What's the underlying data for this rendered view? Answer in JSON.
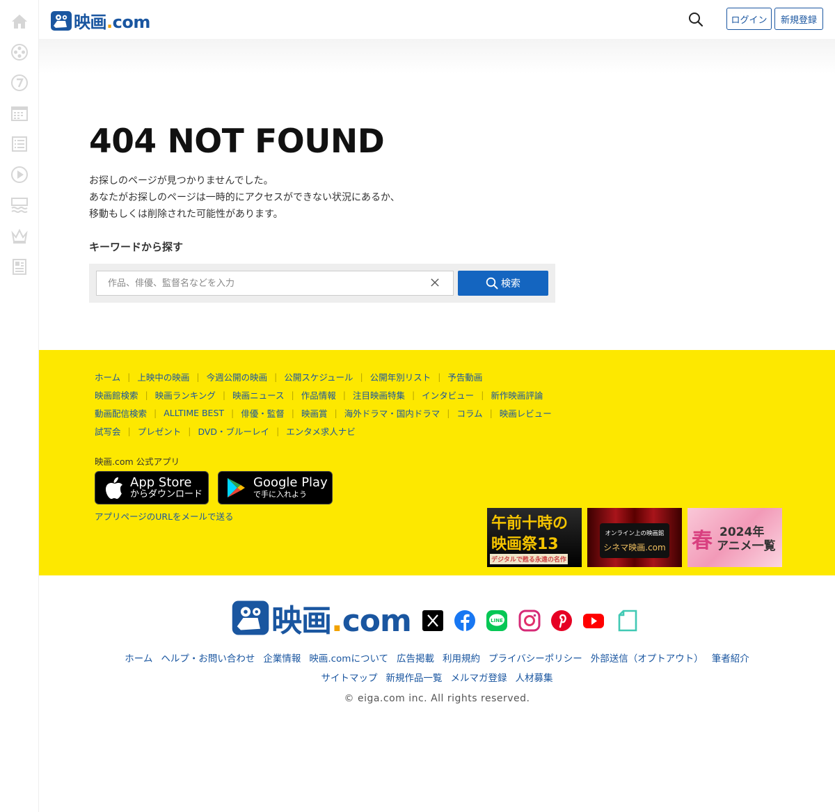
{
  "header": {
    "logo": {
      "mark": "eiga-logo-mark",
      "text_main": "映画",
      "text_dot": ".",
      "text_tail": "com"
    },
    "login_label": "ログイン",
    "register_label": "新規登録"
  },
  "sidebar": {
    "items": [
      {
        "icon": "home-icon"
      },
      {
        "icon": "film-reel-icon"
      },
      {
        "icon": "seven-days-icon"
      },
      {
        "icon": "calendar-icon"
      },
      {
        "icon": "list-icon"
      },
      {
        "icon": "play-icon"
      },
      {
        "icon": "theater-icon"
      },
      {
        "icon": "crown-icon"
      },
      {
        "icon": "news-icon"
      }
    ]
  },
  "main": {
    "title": "404 NOT FOUND",
    "message": [
      "お探しのページが見つかりませんでした。",
      "あなたがお探しのページは一時的にアクセスができない状況にあるか、",
      "移動もしくは削除された可能性があります。"
    ],
    "keyword_title": "キーワードから探す",
    "search": {
      "placeholder": "作品、俳優、監督名などを入力",
      "value": "",
      "submit_label": "検索"
    }
  },
  "yellow_footer": {
    "nav_rows": [
      [
        "ホーム",
        "上映中の映画",
        "今週公開の映画",
        "公開スケジュール",
        "公開年別リスト",
        "予告動画"
      ],
      [
        "映画館検索",
        "映画ランキング",
        "映画ニュース",
        "作品情報",
        "注目映画特集",
        "インタビュー",
        "新作映画評論"
      ],
      [
        "動画配信検索",
        "ALLTIME BEST",
        "俳優・監督",
        "映画賞",
        "海外ドラマ・国内ドラマ",
        "コラム",
        "映画レビュー"
      ],
      [
        "試写会",
        "プレゼント",
        "DVD・ブルーレイ",
        "エンタメ求人ナビ"
      ]
    ],
    "app_label": "映画.com 公式アプリ",
    "appstore": {
      "big": "App Store",
      "small": "からダウンロード"
    },
    "googleplay": {
      "big": "Google Play",
      "small": "で手に入れよう"
    },
    "app_link": "アプリページのURLをメールで送る",
    "banners": [
      {
        "line1": "午前十時の",
        "line2": "映画祭13",
        "line3": "デジタルで甦る永遠の名作"
      },
      {
        "line1": "オンライン上の映画館",
        "line2": "シネマ映画.com"
      },
      {
        "line1": "春",
        "line2": "2024年",
        "line3": "アニメ一覧"
      }
    ]
  },
  "footer": {
    "logo": {
      "text_main": "映画",
      "text_dot": ".",
      "text_tail": "com"
    },
    "social": [
      {
        "icon": "x-icon",
        "color": "#000000"
      },
      {
        "icon": "facebook-icon",
        "color": "#1877f2"
      },
      {
        "icon": "line-icon",
        "color": "#06c755"
      },
      {
        "icon": "instagram-icon",
        "color": "#d62976"
      },
      {
        "icon": "pinterest-icon",
        "color": "#e60023"
      },
      {
        "icon": "youtube-icon",
        "color": "#ff0000"
      },
      {
        "icon": "note-icon",
        "color": "#41c9b4"
      }
    ],
    "links_row1": [
      "ホーム",
      "ヘルプ・お問い合わせ",
      "企業情報",
      "映画.comについて",
      "広告掲載",
      "利用規約",
      "プライバシーポリシー",
      "外部送信（オプトアウト）",
      "筆者紹介"
    ],
    "links_row2": [
      "サイトマップ",
      "新規作品一覧",
      "メルマガ登録",
      "人材募集"
    ],
    "copyright": "© eiga.com inc. All rights reserved."
  },
  "colors": {
    "brand_blue": "#1a56a0",
    "accent_yellow": "#fde800",
    "search_button": "#1465c0"
  }
}
